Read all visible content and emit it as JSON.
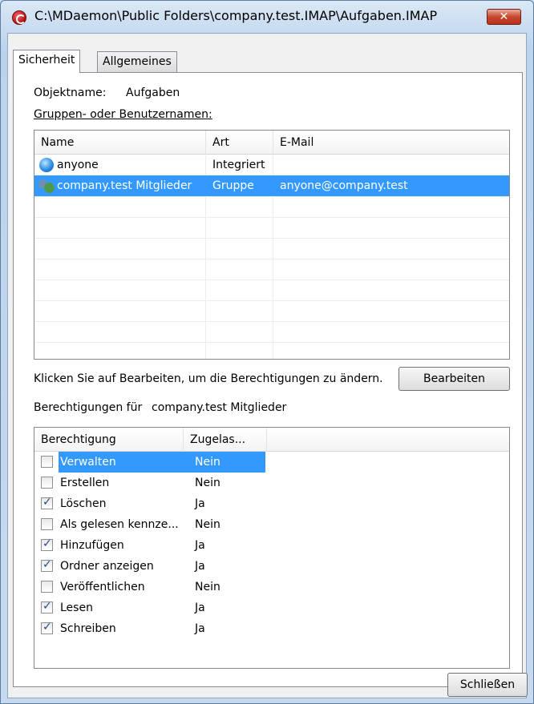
{
  "window": {
    "title": "C:\\MDaemon\\Public Folders\\company.test.IMAP\\Aufgaben.IMAP",
    "close_label": "✕",
    "accent": "#3399ff"
  },
  "tabs": [
    {
      "label": "Sicherheit",
      "active": true
    },
    {
      "label": "Allgemeines",
      "active": false
    }
  ],
  "security": {
    "object_label": "Objektname:",
    "object_value": "Aufgaben",
    "groups_label": "Gruppen- oder Benutzernamen:",
    "columns": [
      "Name",
      "Art",
      "E-Mail"
    ],
    "users": [
      {
        "icon": "globe-icon",
        "name": "anyone",
        "type": "Integriert",
        "email": "",
        "selected": false
      },
      {
        "icon": "group-icon",
        "name": "company.test Mitglieder",
        "type": "Gruppe",
        "email": "anyone@company.test",
        "selected": true
      }
    ],
    "hint": "Klicken Sie auf Bearbeiten, um die Berechtigungen zu ändern.",
    "edit_button": "Bearbeiten",
    "permissions_for_label": "Berechtigungen für",
    "permissions_for_value": "company.test Mitglieder",
    "perm_columns": [
      "Berechtigung",
      "Zugelas..."
    ],
    "permissions": [
      {
        "name": "Verwalten",
        "value": "Nein",
        "checked": false,
        "selected": true
      },
      {
        "name": "Erstellen",
        "value": "Nein",
        "checked": false,
        "selected": false
      },
      {
        "name": "Löschen",
        "value": "Ja",
        "checked": true,
        "selected": false
      },
      {
        "name": "Als gelesen kennze...",
        "value": "Nein",
        "checked": false,
        "selected": false
      },
      {
        "name": "Hinzufügen",
        "value": "Ja",
        "checked": true,
        "selected": false
      },
      {
        "name": "Ordner anzeigen",
        "value": "Ja",
        "checked": true,
        "selected": false
      },
      {
        "name": "Veröffentlichen",
        "value": "Nein",
        "checked": false,
        "selected": false
      },
      {
        "name": "Lesen",
        "value": "Ja",
        "checked": true,
        "selected": false
      },
      {
        "name": "Schreiben",
        "value": "Ja",
        "checked": true,
        "selected": false
      }
    ]
  },
  "footer": {
    "close_button": "Schließen"
  }
}
